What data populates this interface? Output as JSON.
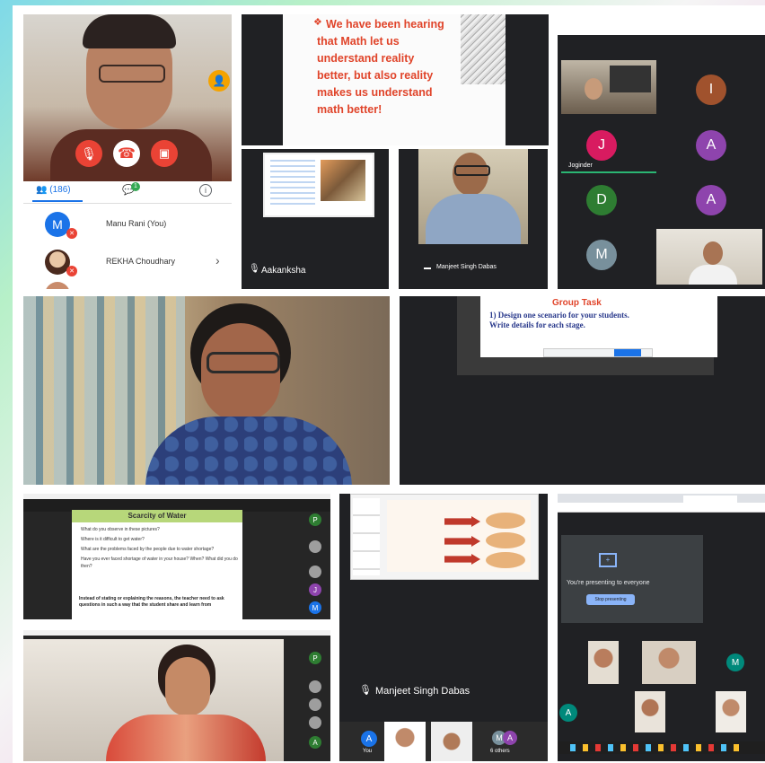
{
  "tile_phone": {
    "participants_tab_count": "(186)",
    "chat_badge": "1",
    "participants": [
      {
        "initial": "M",
        "name": "Manu Rani (You)"
      },
      {
        "initial": "",
        "name": "REKHA Choudhary"
      }
    ]
  },
  "tile_slide_quote": {
    "text_lines": [
      "We have been hearing",
      "that  Math let us",
      "understand  reality",
      "better, but also  reality",
      "makes us understand",
      "math better!"
    ]
  },
  "tile_aakanksha": {
    "name": "Aakanksha"
  },
  "tile_manjeet_small": {
    "name": "Manjeet Singh Dabas"
  },
  "tile_grid": {
    "name_small": "Joginder",
    "avatars": [
      "I",
      "J",
      "A",
      "D",
      "A",
      "M"
    ]
  },
  "tile_group_task": {
    "title": "Group Task",
    "lines": [
      "1) Design one scenario for your students.",
      "Write details for each stage."
    ]
  },
  "tile_water": {
    "slide_title": "Scarcity of Water",
    "questions": [
      "What do you observe in these pictures?",
      "Where is it difficult to get water?",
      "What are the problems faced by the people due to water shortage?",
      "Have you ever faced shortage of water in your house? When? What did you do then?"
    ],
    "footer_text": "Instead of stating or explaining the reasons, the teacher need to ask questions in such a way that the student share and learn from",
    "side_avatars": [
      "P",
      "",
      "",
      "J",
      "M"
    ]
  },
  "tile_teacher_bottom": {
    "side_avatars": [
      "P",
      "",
      "",
      "",
      "A"
    ]
  },
  "tile_manjeet_big": {
    "name": "Manjeet Singh Dabas",
    "avatar_initial": "A",
    "others_initials": [
      "M",
      "A"
    ],
    "others_label": "6 others",
    "you_label": "You"
  },
  "tile_presenting": {
    "presenting_text": "You're presenting to everyone",
    "stop_button": "Stop presenting",
    "avatar_initials": [
      "M",
      "A"
    ]
  },
  "colors": {
    "meet_dark": "#202124",
    "red": "#ea4335",
    "orange_text": "#e0442a",
    "green": "#34a853",
    "blue": "#1a73e8",
    "pink": "#d81b60",
    "purple": "#8e44ad",
    "brown": "#a0522d"
  }
}
